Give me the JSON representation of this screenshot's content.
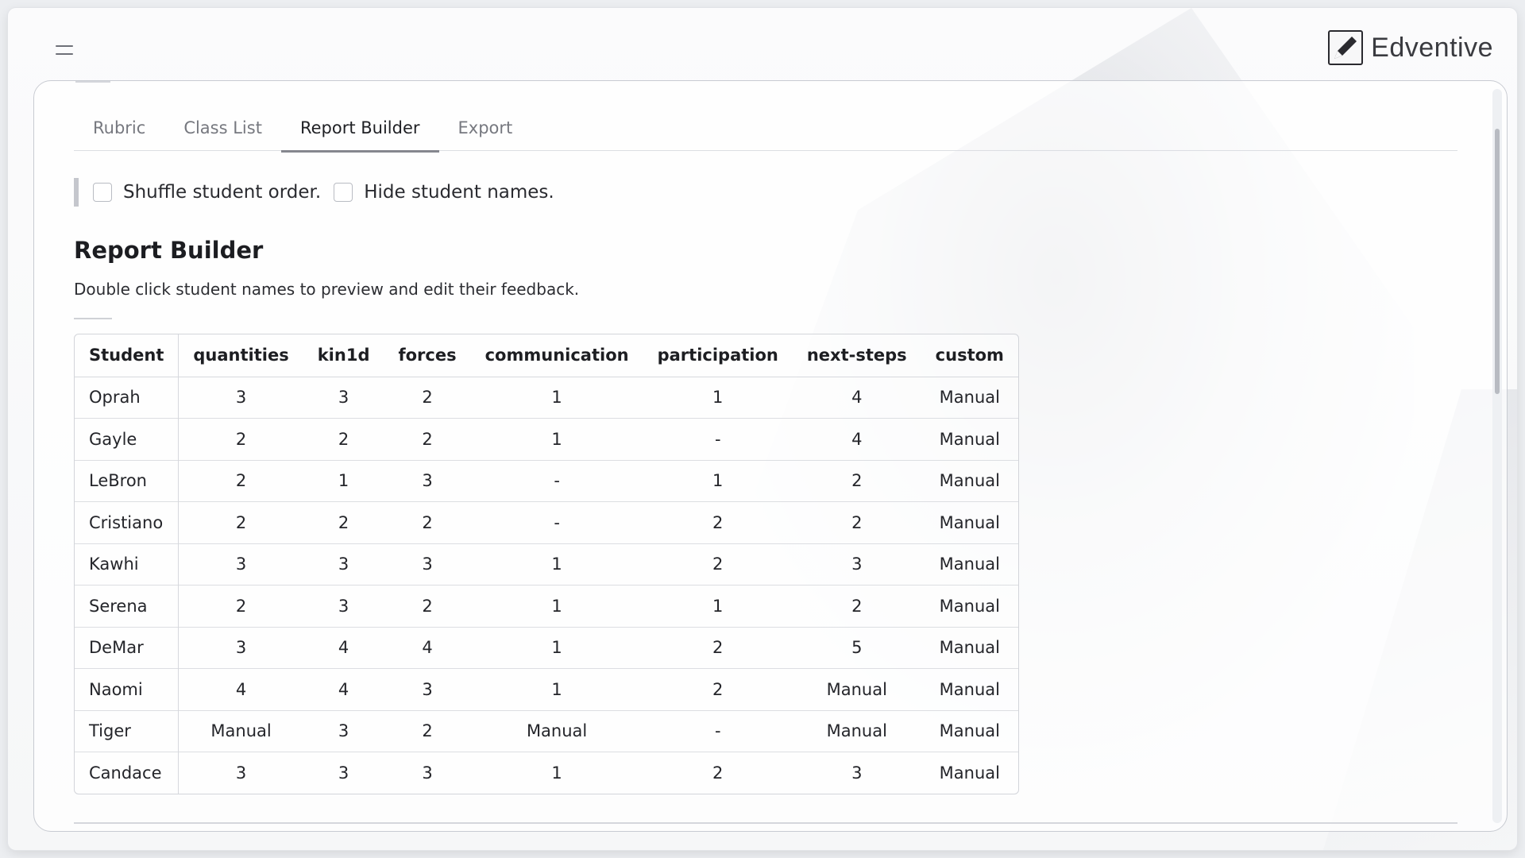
{
  "brand": {
    "name": "Edventive",
    "logo_icon": "pen-square-icon"
  },
  "tabs": [
    {
      "label": "Rubric",
      "active": false
    },
    {
      "label": "Class List",
      "active": false
    },
    {
      "label": "Report Builder",
      "active": true
    },
    {
      "label": "Export",
      "active": false
    }
  ],
  "options": {
    "shuffle_label": "Shuffle student order.",
    "shuffle_checked": false,
    "hide_label": "Hide student names.",
    "hide_checked": false
  },
  "report": {
    "title": "Report Builder",
    "description": "Double click student names to preview and edit their feedback."
  },
  "table": {
    "headers": [
      "Student",
      "quantities",
      "kin1d",
      "forces",
      "communication",
      "participation",
      "next-steps",
      "custom"
    ],
    "rows": [
      [
        "Oprah",
        "3",
        "3",
        "2",
        "1",
        "1",
        "4",
        "Manual"
      ],
      [
        "Gayle",
        "2",
        "2",
        "2",
        "1",
        "-",
        "4",
        "Manual"
      ],
      [
        "LeBron",
        "2",
        "1",
        "3",
        "-",
        "1",
        "2",
        "Manual"
      ],
      [
        "Cristiano",
        "2",
        "2",
        "2",
        "-",
        "2",
        "2",
        "Manual"
      ],
      [
        "Kawhi",
        "3",
        "3",
        "3",
        "1",
        "2",
        "3",
        "Manual"
      ],
      [
        "Serena",
        "2",
        "3",
        "2",
        "1",
        "1",
        "2",
        "Manual"
      ],
      [
        "DeMar",
        "3",
        "4",
        "4",
        "1",
        "2",
        "5",
        "Manual"
      ],
      [
        "Naomi",
        "4",
        "4",
        "3",
        "1",
        "2",
        "Manual",
        "Manual"
      ],
      [
        "Tiger",
        "Manual",
        "3",
        "2",
        "Manual",
        "-",
        "Manual",
        "Manual"
      ],
      [
        "Candace",
        "3",
        "3",
        "3",
        "1",
        "2",
        "3",
        "Manual"
      ]
    ]
  }
}
